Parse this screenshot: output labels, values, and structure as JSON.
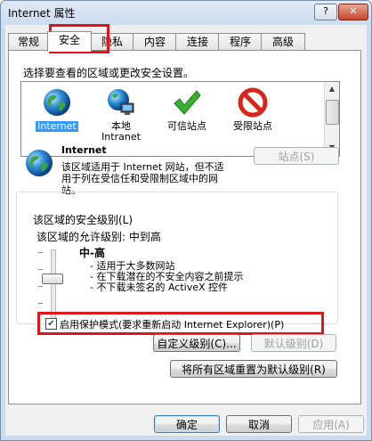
{
  "window": {
    "title": "Internet 属性",
    "help_glyph": "?",
    "close_glyph": "✕"
  },
  "tabs": [
    "常规",
    "安全",
    "隐私",
    "内容",
    "连接",
    "程序",
    "高级"
  ],
  "active_tab": "安全",
  "security": {
    "zone_prompt": "选择要查看的区域或更改安全设置。",
    "zones": [
      {
        "name": "Internet",
        "icon": "globe-icon",
        "selected": true
      },
      {
        "name": "本地\nIntranet",
        "icon": "intranet-globe-icon",
        "selected": false
      },
      {
        "name": "可信站点",
        "icon": "checkmark-icon",
        "selected": false
      },
      {
        "name": "受限站点",
        "icon": "no-entry-icon",
        "selected": false
      }
    ],
    "zone_heading": "Internet",
    "zone_description": "该区域适用于 Internet 网站，但不适用于列在受信任和受限制区域中的网站。",
    "sites_button": "站点(S)",
    "level_group_title": "该区域的安全级别(L)",
    "allowed_levels": "该区域的允许级别: 中到高",
    "level_name": "中-高",
    "level_bullets": [
      "- 适用于大多数网站",
      "- 在下载潜在的不安全内容之前提示",
      "- 不下载未签名的 ActiveX 控件"
    ],
    "slider_level_index": 2,
    "slider_level_count": 4,
    "protected_mode_label": "启用保护模式(要求重新启动 Internet Explorer)(P)",
    "protected_mode_checked": true,
    "custom_level_button": "自定义级别(C)...",
    "default_level_button": "默认级别(D)",
    "reset_all_button": "将所有区域重置为默认级别(R)"
  },
  "footer": {
    "ok": "确定",
    "cancel": "取消",
    "apply": "应用(A)"
  },
  "colors": {
    "highlight": "#e0151a",
    "selection": "#3399ff"
  }
}
